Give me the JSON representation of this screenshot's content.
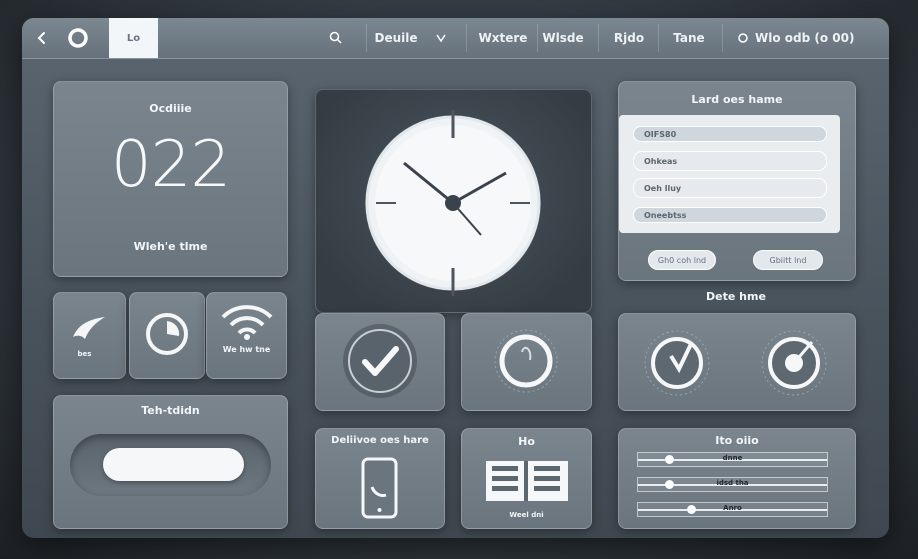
{
  "topbar": {
    "tab_label": "Lo",
    "menu_1": "Deuile",
    "menu_2": "Wxtere",
    "menu_3": "Wlsde",
    "menu_4": "Rjdo",
    "menu_5": "Tane",
    "status": "Wlo odb (o 00)"
  },
  "clock_card": {
    "title": "Ocdiiie",
    "time": "022",
    "caption": "Wleh'e tlme"
  },
  "quick_tiles": {
    "tile_1_label": "bes",
    "tile_3_label": "We hw tne"
  },
  "toggle_card": {
    "title": "Teh-tdidn"
  },
  "form_card": {
    "title": "Lard oes hame",
    "fields": [
      "OIFS80",
      "Ohkeas",
      "Oeh lluy",
      "Oneebtss"
    ],
    "button_1": "Gh0 coh lnd",
    "button_2": "Gbiitt lnd"
  },
  "date_card": {
    "title": "Dete hme"
  },
  "device_card": {
    "title": "Deliivoe oes hare"
  },
  "list_card": {
    "title": "Ho",
    "caption": "Weel dni"
  },
  "slider_card": {
    "title": "Ito oiio",
    "sliders": [
      {
        "label": "dnne",
        "value": 0.16
      },
      {
        "label": "idsd tha",
        "value": 0.16
      },
      {
        "label": "Anro",
        "value": 0.28
      }
    ]
  },
  "colors": {
    "accent": "#f2f5f8",
    "panel": "#727d86",
    "frame": "#525d66"
  },
  "icons": [
    "back-arrow-icon",
    "power-icon",
    "search-icon",
    "chevron-down-icon",
    "radio-icon",
    "check-icon",
    "timer-icon",
    "gauge-icon",
    "phone-icon",
    "list-icon",
    "wifi-icon",
    "swoosh-icon"
  ]
}
